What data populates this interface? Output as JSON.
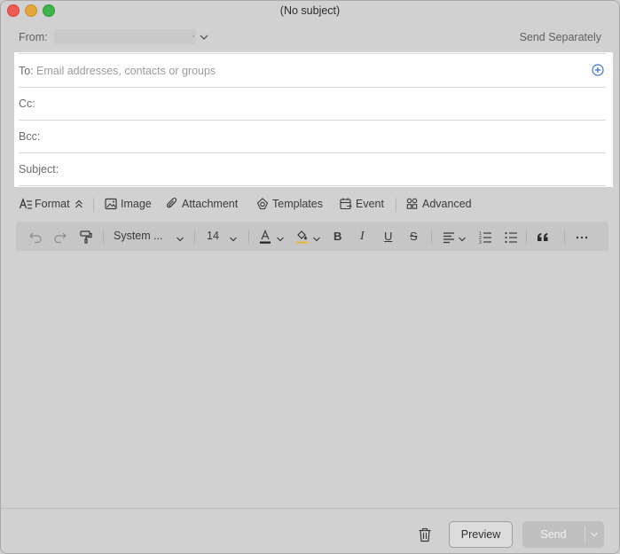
{
  "window": {
    "title": "(No subject)"
  },
  "from": {
    "label": "From:",
    "send_separately": "Send Separately"
  },
  "fields": {
    "to_label": "To:",
    "to_placeholder": "Email addresses, contacts or groups",
    "cc_label": "Cc:",
    "bcc_label": "Bcc:",
    "subject_label": "Subject:"
  },
  "toolbar": {
    "format": "Format",
    "image": "Image",
    "attachment": "Attachment",
    "templates": "Templates",
    "event": "Event",
    "advanced": "Advanced"
  },
  "formatting": {
    "font_family": "System ...",
    "font_size": "14"
  },
  "footer": {
    "preview": "Preview",
    "send": "Send"
  },
  "colors": {
    "accent": "#3b6fd6",
    "text_color_bar": "#1e1e1e",
    "highlight_bar": "#e2b93b"
  }
}
